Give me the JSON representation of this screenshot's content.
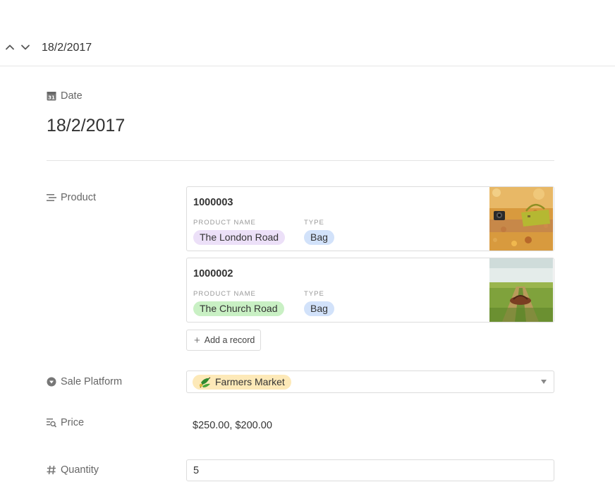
{
  "header": {
    "title": "18/2/2017",
    "prev_icon": "chevron-up-icon",
    "next_icon": "chevron-down-icon"
  },
  "date_field": {
    "label": "Date",
    "icon": "calendar-icon",
    "value": "18/2/2017"
  },
  "product_field": {
    "label": "Product",
    "icon": "linked-record-icon",
    "records": [
      {
        "id": "1000003",
        "product_name_label": "PRODUCT NAME",
        "product_name": "The London Road",
        "product_name_color": "#ece0f8",
        "type_label": "TYPE",
        "type": "Bag",
        "type_color": "#d2e2fa",
        "image": "yellow-bag-autumn-leaves-photo"
      },
      {
        "id": "1000002",
        "product_name_label": "PRODUCT NAME",
        "product_name": "The Church Road",
        "product_name_color": "#c9f0c4",
        "type_label": "TYPE",
        "type": "Bag",
        "type_color": "#d2e2fa",
        "image": "brown-bag-grass-road-photo"
      }
    ],
    "add_label": "Add a record"
  },
  "sale_platform_field": {
    "label": "Sale Platform",
    "icon": "dropdown-circle-icon",
    "value": "Farmers Market",
    "value_icon": "leaf-emoji-icon",
    "value_color": "#fde9b8"
  },
  "price_field": {
    "label": "Price",
    "icon": "lookup-icon",
    "value": "$250.00, $200.00"
  },
  "quantity_field": {
    "label": "Quantity",
    "icon": "hash-icon",
    "value": "5"
  }
}
